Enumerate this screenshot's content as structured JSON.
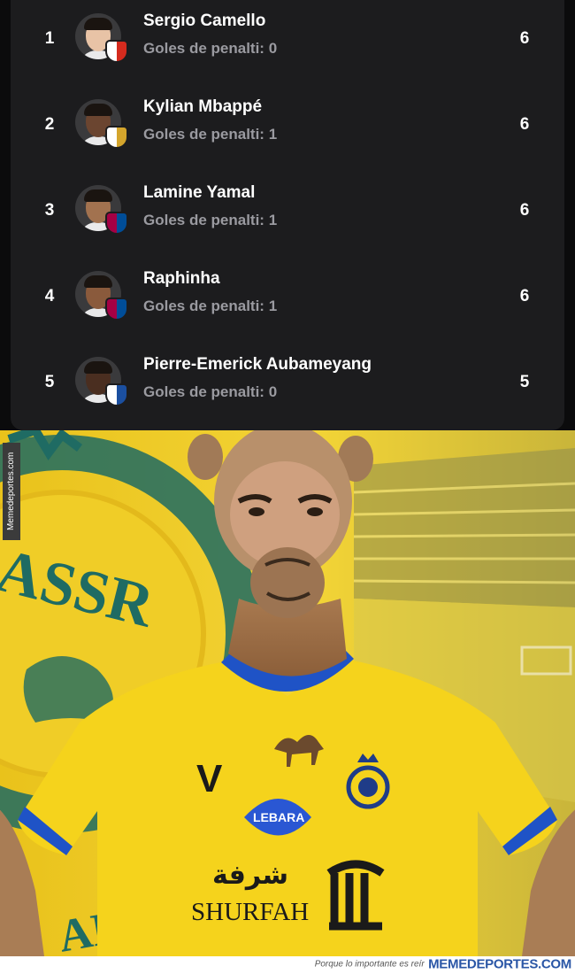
{
  "scorers": [
    {
      "rank": "1",
      "name": "Sergio Camello",
      "penalty_label": "Goles de penalti: 0",
      "goals": "6",
      "club_color": "#ffffff",
      "club_accent": "#d52b1e",
      "skin": "#e8c3a6"
    },
    {
      "rank": "2",
      "name": "Kylian Mbappé",
      "penalty_label": "Goles de penalti: 1",
      "goals": "6",
      "club_color": "#ffffff",
      "club_accent": "#d4a52c",
      "skin": "#6b4530"
    },
    {
      "rank": "3",
      "name": "Lamine Yamal",
      "penalty_label": "Goles de penalti: 1",
      "goals": "6",
      "club_color": "#a50044",
      "club_accent": "#004d98",
      "skin": "#a2724f"
    },
    {
      "rank": "4",
      "name": "Raphinha",
      "penalty_label": "Goles de penalti: 1",
      "goals": "6",
      "club_color": "#a50044",
      "club_accent": "#004d98",
      "skin": "#8a5a3c"
    },
    {
      "rank": "5",
      "name": "Pierre-Emerick Aubameyang",
      "penalty_label": "Goles de penalti: 0",
      "goals": "5",
      "club_color": "#ffffff",
      "club_accent": "#1b4fa0",
      "skin": "#4a2e20"
    }
  ],
  "meme": {
    "crest_text": "ASSR",
    "crest_text_bottom": "ALL",
    "sponsor_badge": "LEBARA",
    "sponsor_script": "شرفة",
    "sponsor": "SHURFAH",
    "kit_letter": "V",
    "side_watermark": "Memedeportes.com",
    "colors": {
      "jersey": "#f5d31c",
      "trim": "#1f53c6",
      "background": "#f1cf2a",
      "camel": "#b58a62"
    }
  },
  "footer": {
    "tagline": "Porque lo importante es reír",
    "brand": "MEMEDEPORTES.COM"
  }
}
